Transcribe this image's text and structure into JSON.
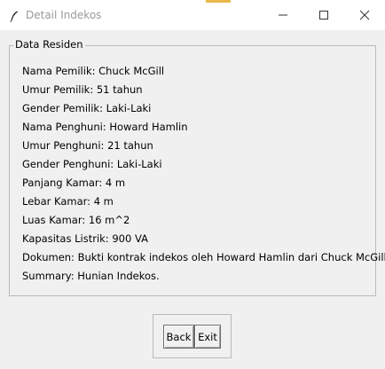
{
  "window": {
    "title": "Detail Indekos",
    "icon": "feather-icon",
    "controls": [
      "minimize-icon",
      "maximize-icon",
      "close-icon"
    ]
  },
  "group": {
    "legend": "Data Residen",
    "lines": [
      "Nama Pemilik: Chuck McGill",
      "Umur Pemilik: 51 tahun",
      "Gender Pemilik: Laki-Laki",
      "Nama Penghuni: Howard Hamlin",
      "Umur Penghuni: 21 tahun",
      "Gender Penghuni: Laki-Laki",
      "Panjang Kamar: 4 m",
      "Lebar Kamar: 4 m",
      "Luas Kamar: 16 m^2",
      "Kapasitas Listrik: 900 VA",
      "Dokumen: Bukti kontrak indekos oleh Howard Hamlin dari Chuck McGill.",
      "Summary: Hunian Indekos."
    ]
  },
  "buttons": {
    "back_label": "Back",
    "exit_label": "Exit"
  }
}
